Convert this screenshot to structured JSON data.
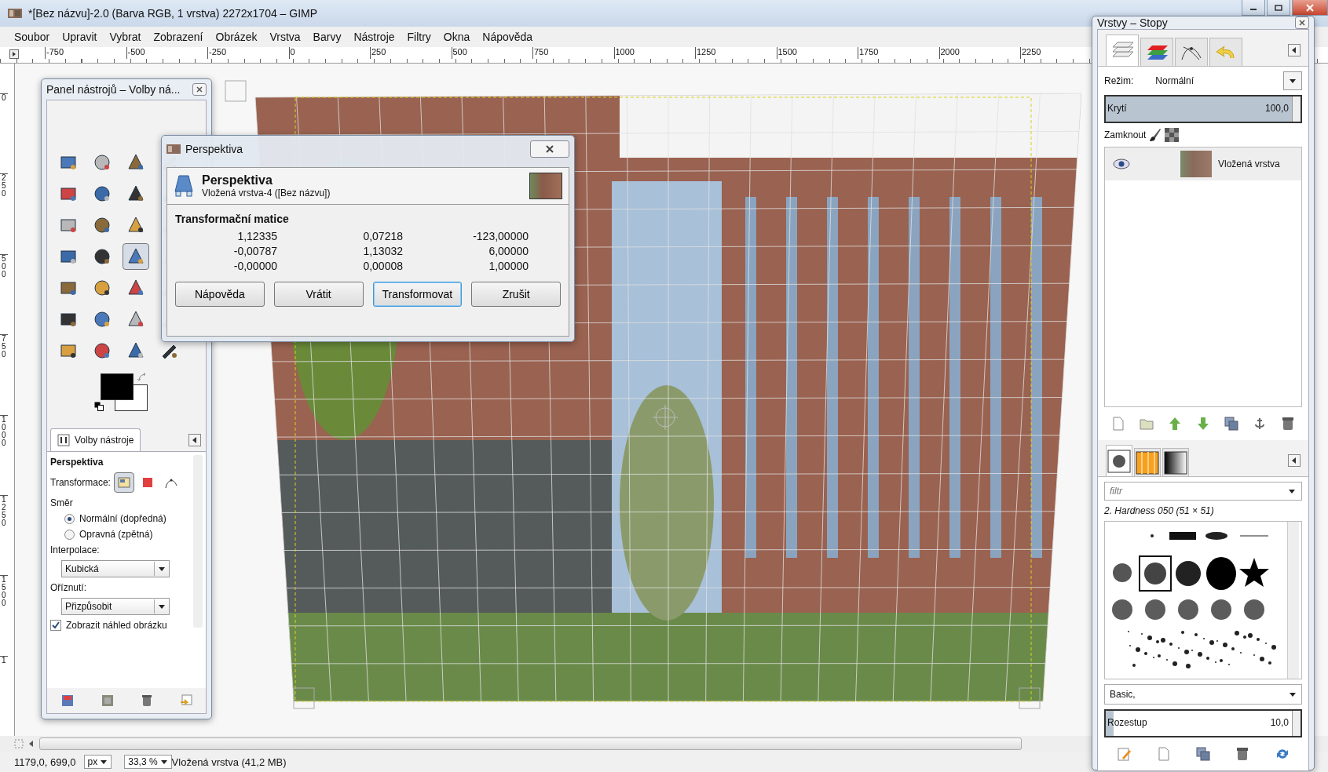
{
  "window": {
    "title": "*[Bez názvu]-2.0 (Barva RGB, 1 vrstva) 2272x1704 – GIMP"
  },
  "menu": [
    {
      "label": "Soubor"
    },
    {
      "label": "Upravit"
    },
    {
      "label": "Vybrat"
    },
    {
      "label": "Zobrazení"
    },
    {
      "label": "Obrázek"
    },
    {
      "label": "Vrstva"
    },
    {
      "label": "Barvy"
    },
    {
      "label": "Nástroje"
    },
    {
      "label": "Filtry"
    },
    {
      "label": "Okna"
    },
    {
      "label": "Nápověda"
    }
  ],
  "hruler": {
    "labels": [
      "-750",
      "-500",
      "-250",
      "0",
      "250",
      "500",
      "750",
      "1000",
      "1250",
      "1500",
      "1750",
      "2000",
      "2250"
    ]
  },
  "vruler": {
    "labels": [
      "0",
      "250",
      "500",
      "750",
      "1000",
      "1250",
      "1500",
      "1"
    ]
  },
  "toolbox": {
    "title": "Panel nástrojů – Volby ná...",
    "tools": [
      {
        "selected": false
      },
      {
        "selected": false
      },
      {
        "selected": false
      },
      {
        "selected": false
      },
      {
        "selected": false
      },
      {
        "selected": false
      },
      {
        "selected": false
      },
      {
        "selected": false
      },
      {
        "selected": false
      },
      {
        "selected": false
      },
      {
        "selected": false
      },
      {
        "selected": false
      },
      {
        "selected": false
      },
      {
        "selected": false
      },
      {
        "selected": true
      },
      {
        "selected": false
      },
      {
        "selected": false
      },
      {
        "selected": false
      },
      {
        "selected": false
      },
      {
        "selected": false
      },
      {
        "selected": false
      },
      {
        "selected": false
      },
      {
        "selected": false
      },
      {
        "selected": false
      },
      {
        "selected": false
      },
      {
        "selected": false
      },
      {
        "selected": false
      },
      {
        "selected": false
      }
    ],
    "foreground": {
      "color": "#000000"
    },
    "background": {
      "color": "#ffffff"
    },
    "tab": "Volby nástroje",
    "options": {
      "heading": "Perspektiva",
      "transform_label": "Transformace:",
      "direction_label": "Směr",
      "directions": [
        {
          "label": "Normální (dopředná)",
          "selected": true
        },
        {
          "label": "Opravná (zpětná)",
          "selected": false
        }
      ],
      "interpolation_label": "Interpolace:",
      "interpolation": "Kubická",
      "clipping_label": "Oříznutí:",
      "clipping": "Přizpůsobit",
      "preview": {
        "label": "Zobrazit náhled obrázku",
        "checked": true
      }
    }
  },
  "dialog": {
    "title": "Perspektiva",
    "heading": "Perspektiva",
    "subtitle": "Vložená vrstva-4 ([Bez názvu])",
    "section": "Transformační matice",
    "matrix": [
      [
        "1,12335",
        "0,07218",
        "-123,00000"
      ],
      [
        "-0,00787",
        "1,13032",
        "6,00000"
      ],
      [
        "-0,00000",
        "0,00008",
        "1,00000"
      ]
    ],
    "buttons": [
      {
        "label": "Nápověda",
        "focused": false
      },
      {
        "label": "Vrátit",
        "focused": false
      },
      {
        "label": "Transformovat",
        "focused": true
      },
      {
        "label": "Zrušit",
        "focused": false
      }
    ]
  },
  "dock": {
    "title": "Vrstvy – Stopy",
    "tabs": [
      {
        "selected": true
      },
      {
        "selected": false
      },
      {
        "selected": false
      },
      {
        "selected": false
      }
    ],
    "mode_label": "Režim:",
    "mode": "Normální",
    "opacity": {
      "label": "Krytí",
      "value": "100,0",
      "level": 1
    },
    "lock_label": "Zamknout",
    "layers": [
      {
        "name": "Vložená vrstva",
        "visible": true,
        "selected": true
      }
    ],
    "brush_tabs": [
      {
        "selected": true
      },
      {
        "selected": false
      },
      {
        "selected": false
      }
    ],
    "filter": {
      "placeholder": "filtr"
    },
    "brush_name": "2. Hardness 050 (51 × 51)",
    "preset": "Basic,",
    "spacing": {
      "label": "Rozestup",
      "value": "10,0",
      "level": 0.04
    }
  },
  "status": {
    "coords": "1179,0, 699,0",
    "unit": "px",
    "zoom": "33,3 %",
    "info": "Vložená vrstva (41,2 MB)"
  }
}
